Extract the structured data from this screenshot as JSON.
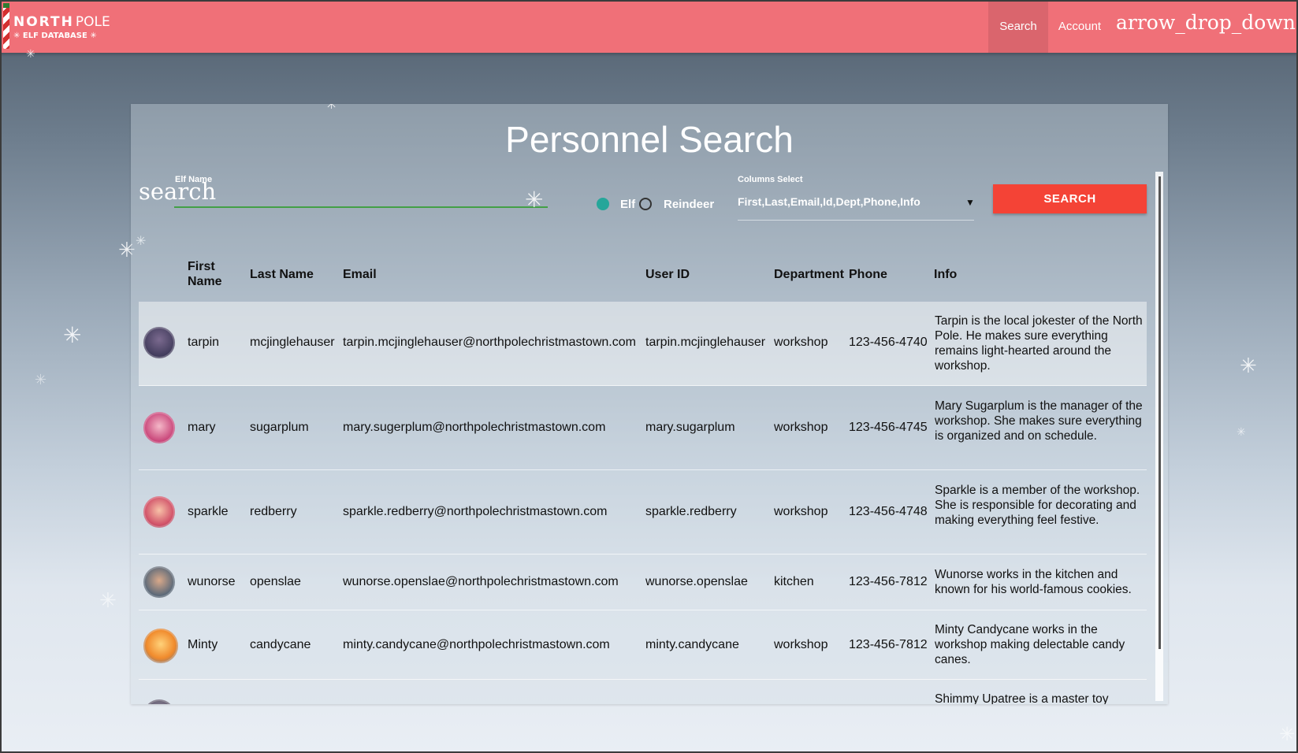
{
  "logo": {
    "north": "NORTH",
    "pole": "POLE",
    "sub": "ELF DATABASE"
  },
  "nav": {
    "search": "Search",
    "account": "Account",
    "dropdown_icon": "arrow_drop_down"
  },
  "page": {
    "title": "Personnel Search",
    "search_label": "Elf Name",
    "search_placeholder": "search",
    "radio_elf": "Elf",
    "radio_reindeer": "Reindeer",
    "columns_label": "Columns Select",
    "columns_value": "First,Last,Email,Id,Dept,Phone,Info",
    "search_button": "SEARCH"
  },
  "table": {
    "headers": [
      "First Name",
      "Last Name",
      "Email",
      "User ID",
      "Department",
      "Phone",
      "Info"
    ],
    "rows": [
      {
        "first": "tarpin",
        "last": "mcjinglehauser",
        "email": "tarpin.mcjinglehauser@northpolechristmastown.com",
        "user_id": "tarpin.mcjinglehauser",
        "dept": "workshop",
        "phone": "123-456-4740",
        "info": "Tarpin is the local jokester of the North Pole. He makes sure everything remains light-hearted around the workshop.",
        "avatar": "elf-avatar-tarpin"
      },
      {
        "first": "mary",
        "last": "sugarplum",
        "email": "mary.sugerplum@northpolechristmastown.com",
        "user_id": "mary.sugarplum",
        "dept": "workshop",
        "phone": "123-456-4745",
        "info": "Mary Sugarplum is the manager of the workshop. She makes sure everything is organized and on schedule.",
        "avatar": "elf-avatar-mary"
      },
      {
        "first": "sparkle",
        "last": "redberry",
        "email": "sparkle.redberry@northpolechristmastown.com",
        "user_id": "sparkle.redberry",
        "dept": "workshop",
        "phone": "123-456-4748",
        "info": "Sparkle is a member of the workshop. She is responsible for decorating and making everything feel festive.",
        "avatar": "elf-avatar-sparkle"
      },
      {
        "first": "wunorse",
        "last": "openslae",
        "email": "wunorse.openslae@northpolechristmastown.com",
        "user_id": "wunorse.openslae",
        "dept": "kitchen",
        "phone": "123-456-7812",
        "info": "Wunorse works in the kitchen and known for his world-famous cookies.",
        "avatar": "elf-avatar-wunorse"
      },
      {
        "first": "Minty",
        "last": "candycane",
        "email": "minty.candycane@northpolechristmastown.com",
        "user_id": "minty.candycane",
        "dept": "workshop",
        "phone": "123-456-7812",
        "info": "Minty Candycane works in the workshop making delectable candy canes.",
        "avatar": "elf-avatar-minty"
      },
      {
        "first": "",
        "last": "",
        "email": "",
        "user_id": "",
        "dept": "",
        "phone": "",
        "info": "Shimmy Upatree is a master toy",
        "avatar": "elf-avatar-shimmy"
      }
    ]
  },
  "colors": {
    "topbar": "#f07078",
    "button": "#f44336",
    "radio_on": "#26a69a",
    "input_line": "#43a047"
  }
}
